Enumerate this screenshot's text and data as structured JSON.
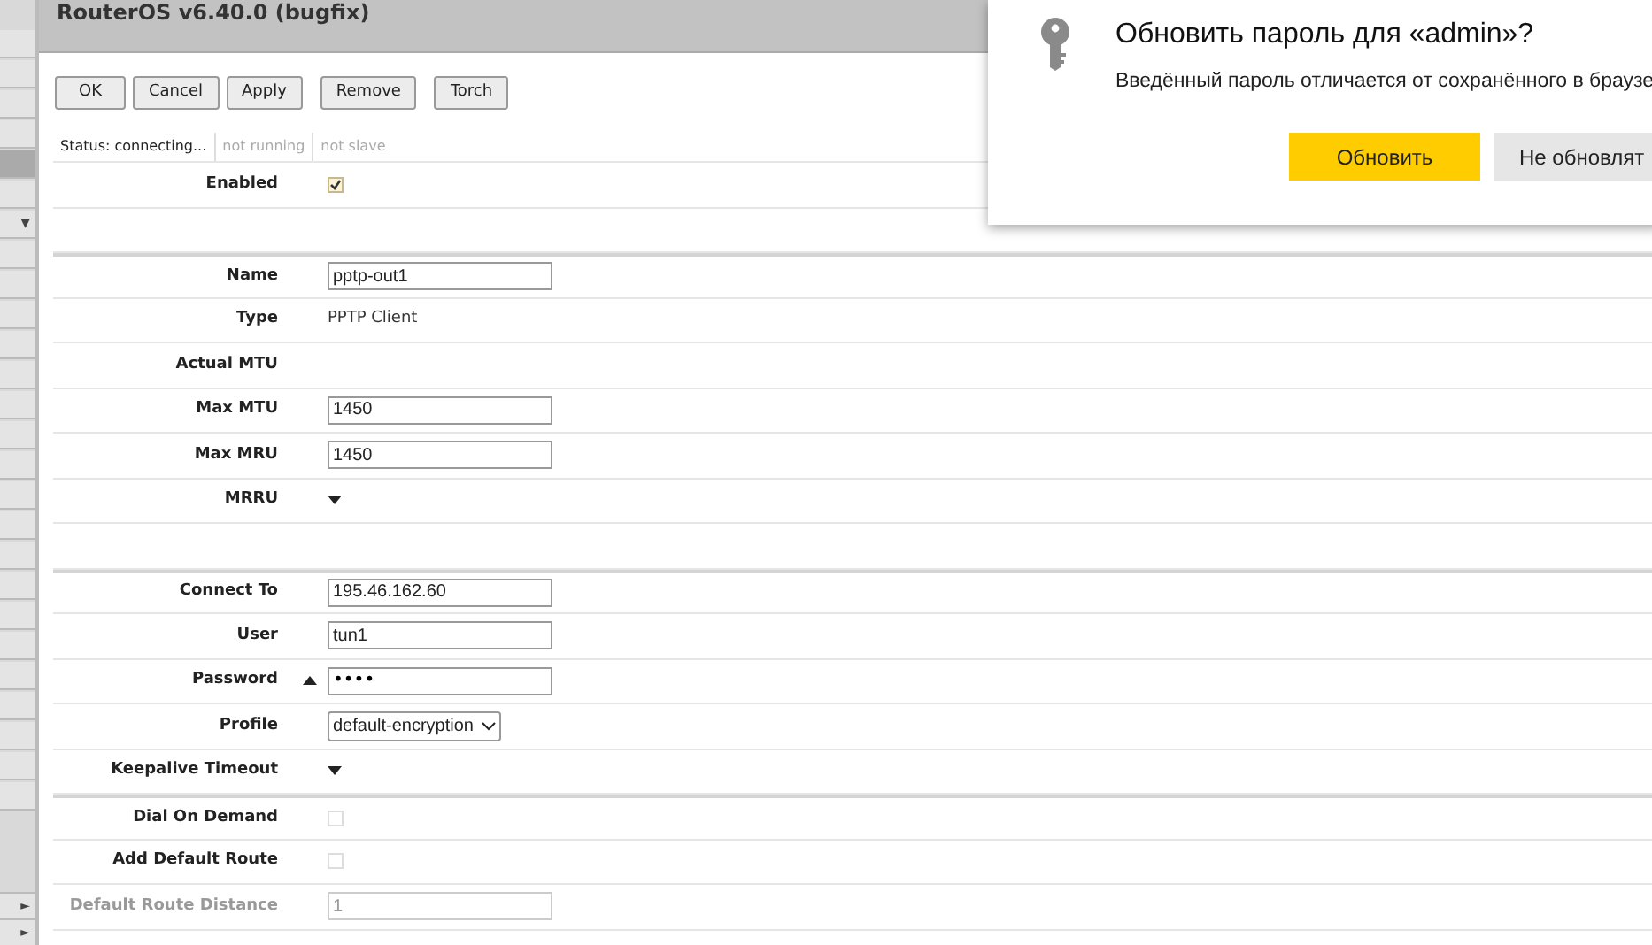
{
  "window": {
    "title": "RouterOS v6.40.0 (bugfix)"
  },
  "sidebar": {
    "items": [
      {
        "selected": false
      },
      {
        "selected": false
      },
      {
        "selected": false
      },
      {
        "selected": false
      },
      {
        "selected": true
      },
      {
        "selected": false
      },
      {
        "selected": false,
        "marker": "▼"
      }
    ],
    "bottom_items": [
      {
        "marker": "►"
      },
      {
        "marker": "►"
      }
    ]
  },
  "toolbar": {
    "buttons": [
      "OK",
      "Cancel",
      "Apply",
      "Remove",
      "Torch"
    ]
  },
  "status_bar": [
    {
      "text": "Status: connecting...",
      "active": true
    },
    {
      "text": "not running",
      "active": false
    },
    {
      "text": "not slave",
      "active": false
    }
  ],
  "form": {
    "rows": [
      {
        "kind": "checkbox",
        "label": "Enabled",
        "checked": true
      },
      {
        "kind": "spacer"
      },
      {
        "kind": "input",
        "label": "Name",
        "value": "pptp-out1",
        "section": true
      },
      {
        "kind": "text",
        "label": "Type",
        "value": "PPTP Client"
      },
      {
        "kind": "text",
        "label": "Actual MTU"
      },
      {
        "kind": "input",
        "label": "Max MTU",
        "value": "1450"
      },
      {
        "kind": "input",
        "label": "Max MRU",
        "value": "1450"
      },
      {
        "kind": "toggle",
        "label": "MRRU",
        "expanded": false
      },
      {
        "kind": "spacer"
      },
      {
        "kind": "input",
        "label": "Connect To",
        "value": "195.46.162.60",
        "section": true
      },
      {
        "kind": "input",
        "label": "User",
        "value": "tun1"
      },
      {
        "kind": "password",
        "label": "Password",
        "value": "••••",
        "expanded": true
      },
      {
        "kind": "select",
        "label": "Profile",
        "value": "default-encryption"
      },
      {
        "kind": "toggle",
        "label": "Keepalive Timeout",
        "expanded": false
      },
      {
        "kind": "checkbox",
        "label": "Dial On Demand",
        "checked": false,
        "section": true
      },
      {
        "kind": "checkbox",
        "label": "Add Default Route",
        "checked": false
      },
      {
        "kind": "input",
        "label": "Default Route Distance",
        "value": "1",
        "disabled": true
      }
    ]
  },
  "popup": {
    "title": "Обновить пароль для «admin»?",
    "text": "Введённый пароль отличается от сохранённого в браузе",
    "buttons": [
      {
        "label": "Обновить",
        "primary": true
      },
      {
        "label": "Не обновлят",
        "primary": false
      }
    ]
  }
}
